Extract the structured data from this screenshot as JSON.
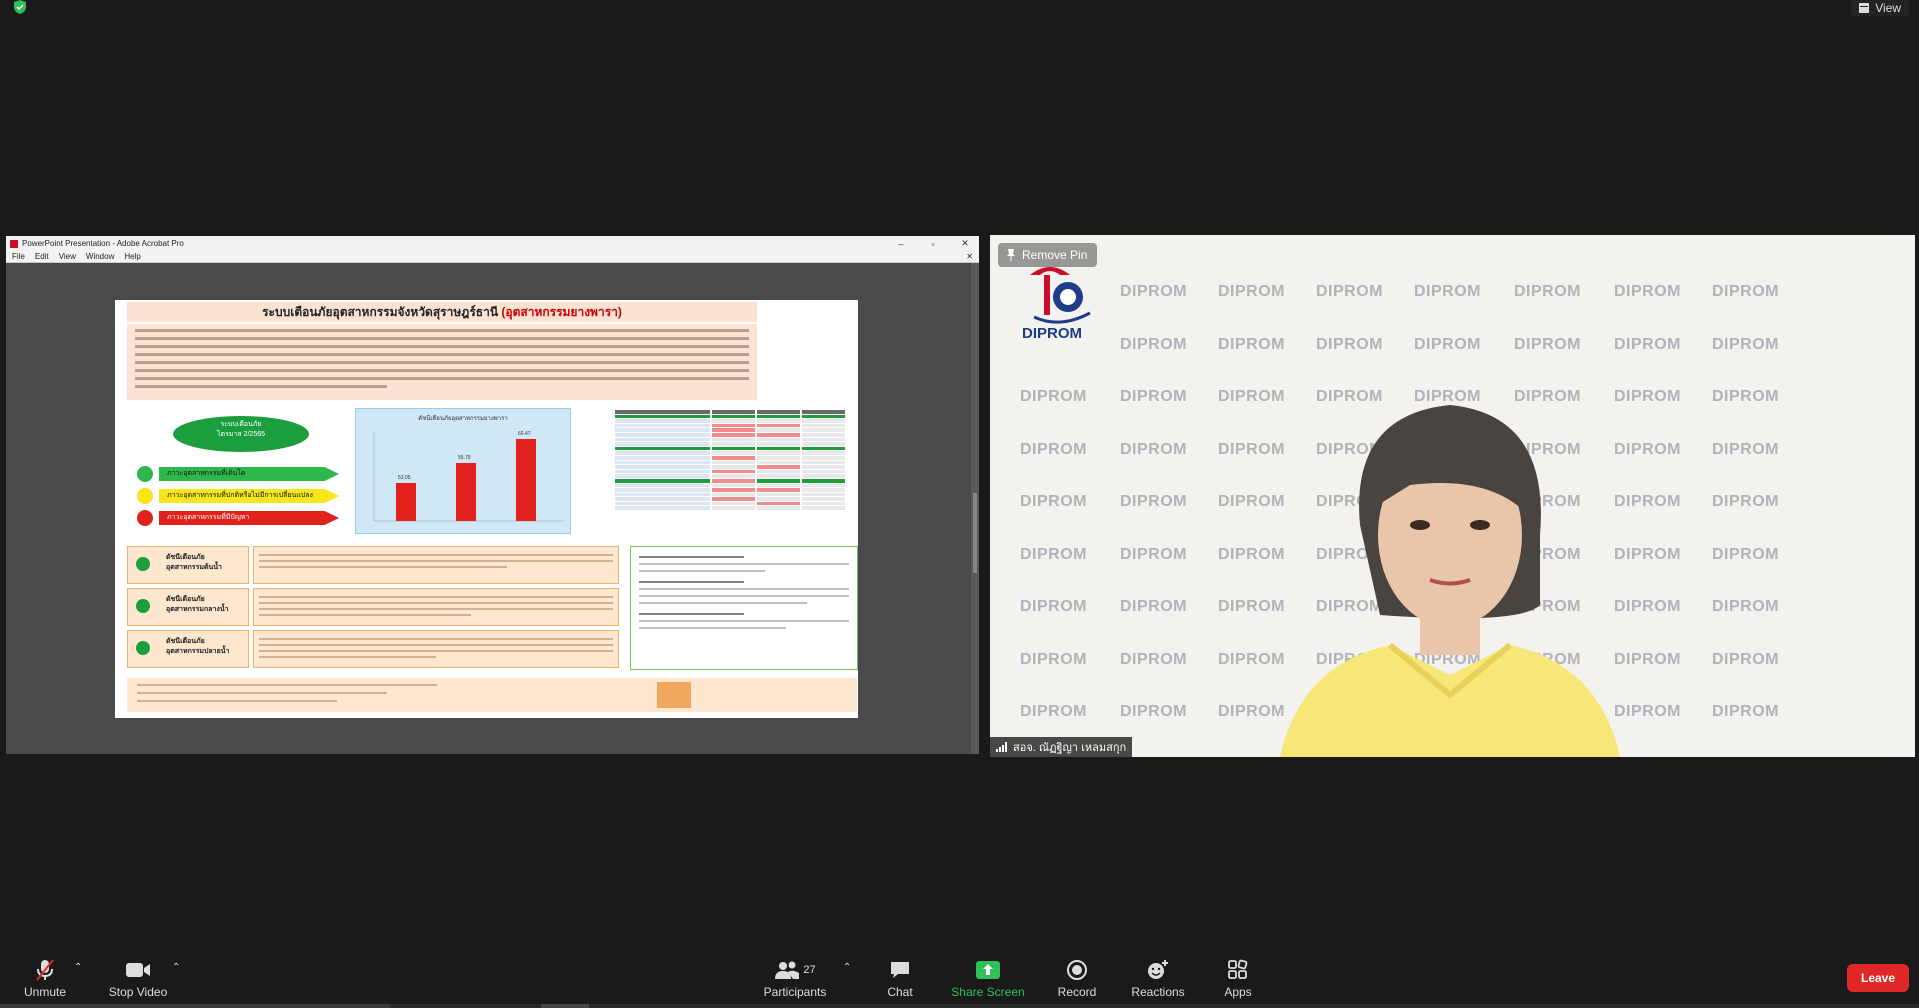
{
  "meeting": {
    "view_label": "View",
    "pin_label": "Remove Pin",
    "participant_name": "สอจ. ณัฏฐิญา เหลมสกุก",
    "participant_count": "27"
  },
  "shared_window": {
    "title": "PowerPoint Presentation - Adobe Acrobat Pro",
    "menu": [
      "File",
      "Edit",
      "View",
      "Window",
      "Help"
    ],
    "win_buttons": [
      "–",
      "▫",
      "✕"
    ],
    "slide_title": "ระบบเตือนภัยอุตสาหกรรมจังหวัดสุราษฎร์ธานี",
    "slide_title_highlight": "(อุตสาหกรรมยางพารา)",
    "oval_title": "ระบบเตือนภัย",
    "oval_sub": "ไตรมาส 2/2565",
    "legend": [
      {
        "label": "ภาวะอุตสาหกรรมที่เติบโต",
        "color": "#2db84b"
      },
      {
        "label": "ภาวะอุตสาหกรรมที่ปกติหรือไม่มีการเปลี่ยนแปลง",
        "color": "#f6e61a"
      },
      {
        "label": "ภาวะอุตสาหกรรมที่มีปัญหา",
        "color": "#e3211c"
      }
    ],
    "chart_title": "ดัชนีเตือนภัยอุตสาหกรรมยางพารา",
    "chart_values": [
      "53.05",
      "55.79",
      "60.47"
    ],
    "rows": [
      {
        "label1": "ดัชนีเตือนภัย",
        "label2": "อุตสาหกรรมต้นน้ำ"
      },
      {
        "label1": "ดัชนีเตือนภัย",
        "label2": "อุตสาหกรรมกลางน้ำ"
      },
      {
        "label1": "ดัชนีเตือนภัย",
        "label2": "อุตสาหกรรมปลายน้ำ"
      }
    ]
  },
  "toolbar": {
    "unmute": "Unmute",
    "stop_video": "Stop Video",
    "participants": "Participants",
    "chat": "Chat",
    "share_screen": "Share Screen",
    "record": "Record",
    "reactions": "Reactions",
    "apps": "Apps",
    "leave": "Leave"
  },
  "colors": {
    "share_green": "#2fbf5b",
    "leave_red": "#e02828",
    "slide_green": "#1b9e3e",
    "slide_red": "#e3211c"
  },
  "watermark_text": "DIPROM",
  "logo_text": "DIPROM"
}
